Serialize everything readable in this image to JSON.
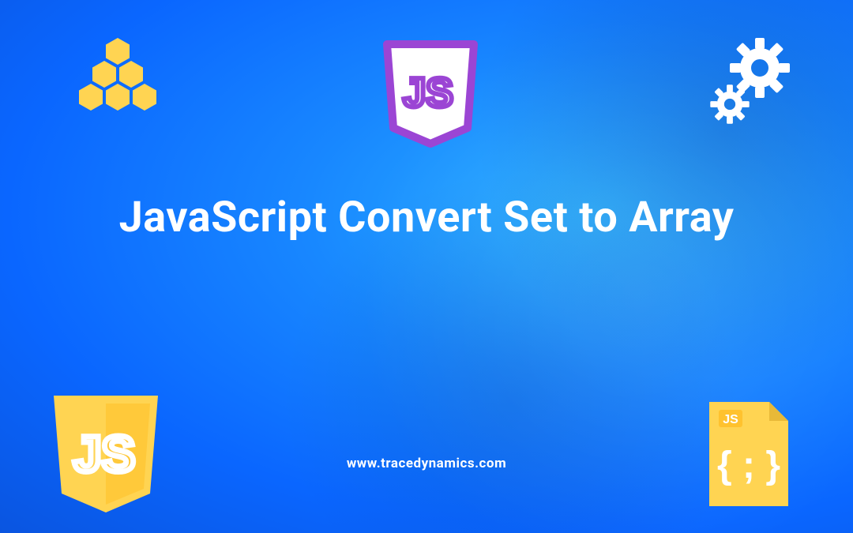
{
  "title": "JavaScript Convert Set to Array",
  "website": "www.tracedynamics.com",
  "icons": {
    "hexagons": "hexagons-icon",
    "jsShieldTop": "js-shield-purple",
    "gears": "gears-icon",
    "jsShieldBottom": "js-shield-yellow",
    "jsFile": "js-file-icon"
  },
  "colors": {
    "accentYellow": "#ffd452",
    "accentPurple": "#9b45d4",
    "white": "#ffffff",
    "bgBlue": "#1887ff"
  }
}
